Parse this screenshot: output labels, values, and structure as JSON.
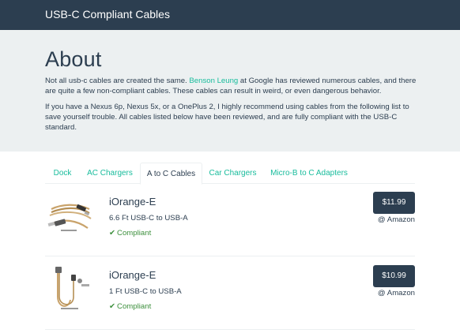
{
  "navbar": {
    "brand": "USB-C Compliant Cables"
  },
  "about": {
    "title": "About",
    "para1_before": "Not all usb-c cables are created the same. ",
    "para1_link": "Benson Leung",
    "para1_after": " at Google has reviewed numerous cables, and there are quite a few non-compliant cables. These cables can result in weird, or even dangerous behavior.",
    "para2": "If you have a Nexus 6p, Nexus 5x, or a OnePlus 2, I highly recommend using cables from the following list to save yourself trouble. All cables listed below have been reviewed, and are fully compliant with the USB-C standard."
  },
  "tabs": [
    {
      "label": "Dock",
      "active": false
    },
    {
      "label": "AC Chargers",
      "active": false
    },
    {
      "label": "A to C Cables",
      "active": true
    },
    {
      "label": "Car Chargers",
      "active": false
    },
    {
      "label": "Micro-B to C Adapters",
      "active": false
    }
  ],
  "products": [
    {
      "name": "iOrange-E",
      "description": "6.6 Ft USB-C to USB-A",
      "status": "Compliant",
      "status_icon": "check-icon",
      "price": "$11.99",
      "store": "@ Amazon"
    },
    {
      "name": "iOrange-E",
      "description": "1 Ft USB-C to USB-A",
      "status": "Compliant",
      "status_icon": "check-icon",
      "price": "$10.99",
      "store": "@ Amazon"
    }
  ],
  "colors": {
    "navbar": "#2c3e50",
    "jumbotron": "#ecf0f1",
    "link": "#18bc9c",
    "compliant": "#3c8f3c",
    "button": "#2c3e50"
  }
}
